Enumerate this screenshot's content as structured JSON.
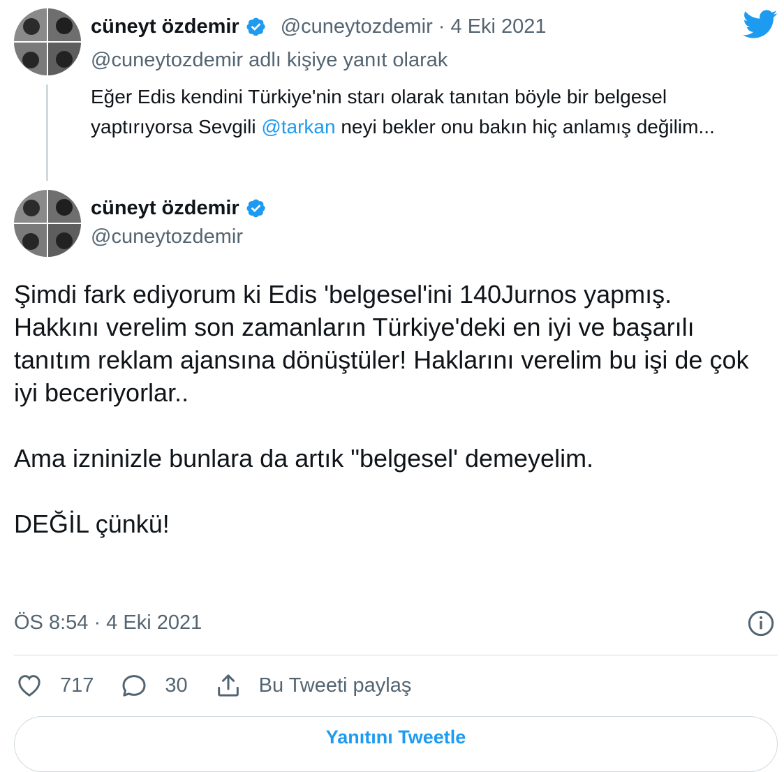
{
  "parent_tweet": {
    "author_name": "cüneyt özdemir",
    "handle_and_date": "@cuneytozdemir · 4 Eki 2021",
    "reply_context": "@cuneytozdemir adlı kişiye yanıt olarak",
    "text_before_mention": "Eğer Edis kendini Türkiye'nin starı olarak tanıtan böyle bir belgesel yaptırıyorsa Sevgili ",
    "mention": "@tarkan",
    "text_after_mention": " neyi bekler onu bakın hiç anlamış değilim..."
  },
  "main_tweet": {
    "author_name": "cüneyt özdemir",
    "handle": "@cuneytozdemir",
    "paragraphs": [
      "Şimdi fark ediyorum ki Edis 'belgesel'ini 140Jurnos yapmış.",
      "Hakkını verelim son zamanların Türkiye'deki en iyi ve başarılı tanıtım reklam ajansına dönüştüler! Haklarını verelim bu işi de çok iyi beceriyorlar..",
      "Ama izninizle bunlara da artık \"belgesel' demeyelim.",
      "DEĞİL çünkü!"
    ],
    "timestamp": "ÖS 8:54 · 4 Eki 2021"
  },
  "actions": {
    "like_count": "717",
    "reply_count": "30",
    "share_label": "Bu Tweeti paylaş"
  },
  "reply_button_label": "Yanıtını Tweetle",
  "icons": {
    "brand": "twitter-bird-icon",
    "verified": "verified-badge-icon",
    "info": "info-icon",
    "like": "heart-icon",
    "reply": "speech-bubble-icon",
    "share": "share-icon"
  },
  "colors": {
    "accent": "#1d9bf0",
    "secondary_text": "#536471",
    "primary_text": "#0f1419",
    "border": "#cfd9de"
  }
}
